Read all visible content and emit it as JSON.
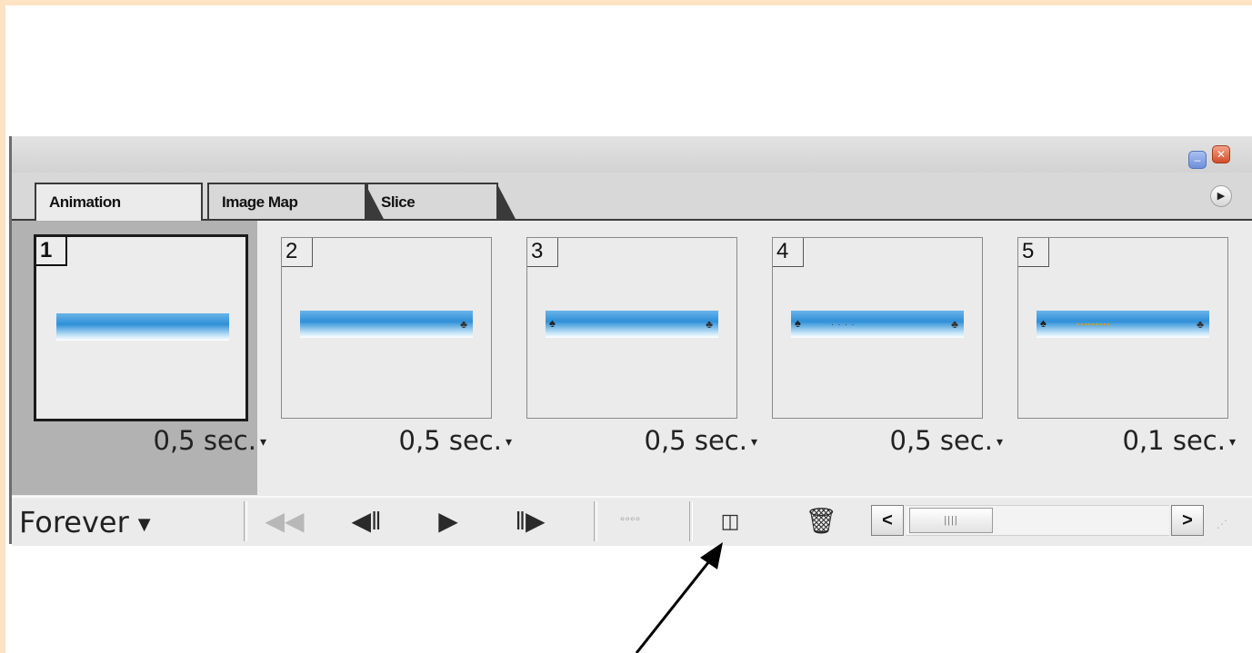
{
  "window": {
    "minimize_icon": "minimize-icon",
    "close_icon": "close-icon",
    "close_glyph": "✕",
    "minimize_glyph": "–"
  },
  "tabs": [
    {
      "label": "Animation",
      "active": true
    },
    {
      "label": "Image Map",
      "active": false
    },
    {
      "label": "Slice",
      "active": false
    }
  ],
  "palette_menu_glyph": "▶",
  "frames": [
    {
      "number": "1",
      "delay": "0,5 sec.",
      "selected": true
    },
    {
      "number": "2",
      "delay": "0,5 sec.",
      "selected": false
    },
    {
      "number": "3",
      "delay": "0,5 sec.",
      "selected": false
    },
    {
      "number": "4",
      "delay": "0,5 sec.",
      "selected": false
    },
    {
      "number": "5",
      "delay": "0,1 sec.",
      "selected": false
    }
  ],
  "delay_caret": "▾",
  "toolbar": {
    "loop_value": "Forever",
    "loop_arrow": "▼",
    "first_frame_glyph": "◀◀",
    "prev_frame_glyph": "◀‖",
    "play_glyph": "▶",
    "next_frame_glyph": "‖▶",
    "tween_glyph": "°°°°",
    "duplicate_glyph": "◫",
    "trash_glyph": "🗑",
    "scroll_left_glyph": "<",
    "scroll_right_glyph": ">",
    "scroll_thumb_grip": "||||",
    "resize_grip": "⋰"
  },
  "colors": {
    "slide_accent": "#fde3c4",
    "banner_blue": "#2f8fd8",
    "selected_frame_bg": "#b2b2b2"
  }
}
